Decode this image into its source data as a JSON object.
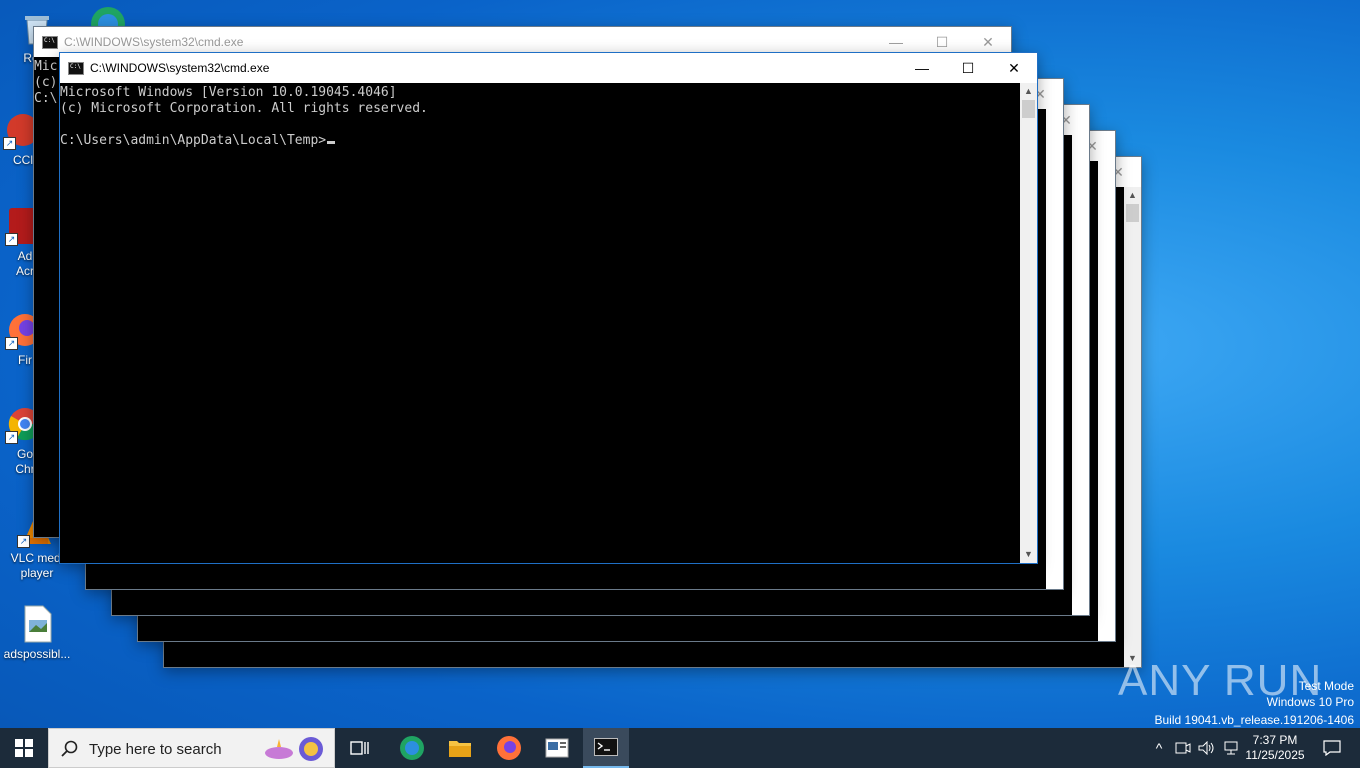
{
  "desktop_icons": [
    {
      "label": "Recy",
      "icon": "recycle-bin-icon"
    },
    {
      "label": "CCl",
      "icon": "ccleaner-icon"
    },
    {
      "label": "Ad\nAcr",
      "icon": "adobe-acrobat-icon"
    },
    {
      "label": "Fir",
      "icon": "firefox-icon"
    },
    {
      "label": "Go\nChr",
      "icon": "chrome-icon"
    },
    {
      "label": "VLC medi\nplayer",
      "icon": "vlc-icon"
    },
    {
      "label": "adspossibl...",
      "icon": "image-file-icon"
    }
  ],
  "back_window": {
    "title": "C:\\WINDOWS\\system32\\cmd.exe",
    "console_lines": [
      "Mic",
      "(c)",
      "",
      "C:\\"
    ]
  },
  "front_window": {
    "title": "C:\\WINDOWS\\system32\\cmd.exe",
    "console_lines": [
      "Microsoft Windows [Version 10.0.19045.4046]",
      "(c) Microsoft Corporation. All rights reserved.",
      "",
      "C:\\Users\\admin\\AppData\\Local\\Temp>"
    ]
  },
  "taskbar": {
    "search_placeholder": "Type here to search",
    "time": "7:37 PM",
    "date": "11/25/2025"
  },
  "watermark": {
    "brand": "ANY RUN",
    "line1": "Test Mode",
    "line2": "Windows 10 Pro",
    "line3": "Build 19041.vb_release.191206-1406"
  },
  "colors": {
    "console_bg": "#000000",
    "console_fg": "#cccccc",
    "taskbar_bg": "#1c2b3a",
    "desktop_blue": "#0a63c9"
  }
}
